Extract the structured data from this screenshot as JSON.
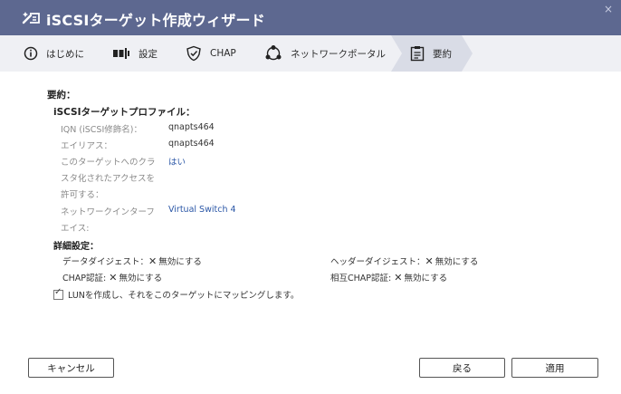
{
  "window": {
    "title": "iSCSIターゲット作成ウィザード",
    "close_glyph": "×"
  },
  "steps": [
    {
      "label": "はじめに",
      "icon": "info-circle-icon"
    },
    {
      "label": "設定",
      "icon": "server-icon"
    },
    {
      "label": "CHAP",
      "icon": "shield-check-icon"
    },
    {
      "label": "ネットワークポータル",
      "icon": "network-nodes-icon"
    },
    {
      "label": "要約",
      "icon": "clipboard-icon",
      "active": true
    }
  ],
  "summary": {
    "heading": "要約：",
    "profile_heading": "iSCSIターゲットプロファイル：",
    "fields": [
      {
        "label": "IQN (iSCSI修飾名)：",
        "value": "qnapts464"
      },
      {
        "label": "エイリアス：",
        "value": "qnapts464"
      },
      {
        "label_lines": [
          "このターゲットへのクラ",
          "スタ化されたアクセスを",
          "許可する："
        ],
        "value": "はい"
      },
      {
        "label_lines": [
          "ネットワークインターフ",
          "エイス:"
        ],
        "value": "Virtual Switch 4"
      }
    ],
    "details_heading": "詳細設定：",
    "details": [
      {
        "label": "データダイジェスト：",
        "value": "無効にする"
      },
      {
        "label": "ヘッダーダイジェスト：",
        "value": "無効にする"
      },
      {
        "label": "CHAP認証:",
        "value": "無効にする"
      },
      {
        "label": "相互CHAP認証:",
        "value": "無効にする"
      }
    ],
    "x_glyph": "✕",
    "lun_checkbox": {
      "label": "LUNを作成し、それをこのターゲットにマッピングします。",
      "checked": true
    }
  },
  "buttons": {
    "cancel": "キャンセル",
    "back": "戻る",
    "apply": "適用"
  },
  "colors": {
    "titlebar": "#5d6890",
    "stepbar": "#eff0f4",
    "active_step": "#d9dce6",
    "link_blue": "#2a56a6"
  }
}
